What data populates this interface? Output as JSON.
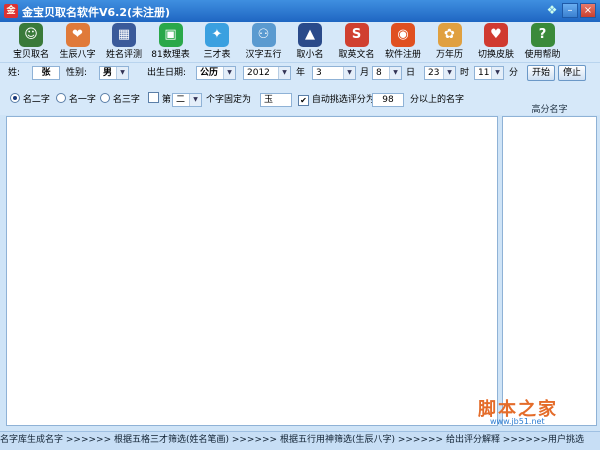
{
  "window": {
    "title": "金宝贝取名软件V6.2(未注册)",
    "app_icon_text": "金"
  },
  "toolbar": [
    {
      "label": "宝贝取名",
      "icon": "baby-icon",
      "color": "#3a7a3a",
      "glyph": "☺"
    },
    {
      "label": "生辰八字",
      "icon": "heart-icon",
      "color": "#e07a3a",
      "glyph": "❤"
    },
    {
      "label": "姓名评测",
      "icon": "grid-icon",
      "color": "#3a5a9a",
      "glyph": "▦"
    },
    {
      "label": "81数理表",
      "icon": "chat-icon",
      "color": "#2aa84a",
      "glyph": "▣"
    },
    {
      "label": "三才表",
      "icon": "bird-icon",
      "color": "#3aa0e0",
      "glyph": "✦"
    },
    {
      "label": "汉字五行",
      "icon": "people-icon",
      "color": "#5a9ad0",
      "glyph": "⚇"
    },
    {
      "label": "取小名",
      "icon": "car-icon",
      "color": "#2a4a8a",
      "glyph": "▲"
    },
    {
      "label": "取英文名",
      "icon": "stumble-icon",
      "color": "#d04030",
      "glyph": "S"
    },
    {
      "label": "软件注册",
      "icon": "robot-icon",
      "color": "#e05020",
      "glyph": "◉"
    },
    {
      "label": "万年历",
      "icon": "flower-icon",
      "color": "#e0a040",
      "glyph": "✿"
    },
    {
      "label": "切换皮肤",
      "icon": "skin-icon",
      "color": "#d03a30",
      "glyph": "♥"
    },
    {
      "label": "使用帮助",
      "icon": "help-icon",
      "color": "#3a8a3a",
      "glyph": "?"
    }
  ],
  "form": {
    "surname_label": "姓:",
    "surname_value": "张",
    "gender_label": "性别:",
    "gender_value": "男",
    "birth_label": "出生日期:",
    "calendar_value": "公历",
    "year_value": "2012",
    "year_unit": "年",
    "month_value": "3",
    "month_unit": "月",
    "day_value": "8",
    "day_unit": "日",
    "hour_value": "23",
    "hour_unit": "时",
    "minute_value": "11",
    "minute_unit": "分",
    "start_button": "开始",
    "stop_button": "停止",
    "opt_two": "名二字",
    "opt_one": "名一字",
    "opt_three": "名三字",
    "fixed_pos_label": "第",
    "fixed_pos_value": "二",
    "fixed_char_label": "个字固定为",
    "fixed_char_value": "玉",
    "auto_filter_label": "自动挑选评分为",
    "score_value": "98",
    "score_suffix": "分以上的名字",
    "selected_option": "名二字",
    "auto_filter_checked": true,
    "fixed_checked": false
  },
  "side_header": "高分名字",
  "status": "名字库生成名字  >>>>>>  根据五格三才筛选(姓名笔画)  >>>>>>  根据五行用神筛选(生辰八字)  >>>>>>  给出评分解释  >>>>>>用户挑选",
  "watermark": {
    "text": "脚本之家",
    "sub": "www.jb51.net"
  },
  "colors": {
    "title_bar": "#1f66c2",
    "panel": "#d6e8f9",
    "accent": "#e46c2a"
  }
}
